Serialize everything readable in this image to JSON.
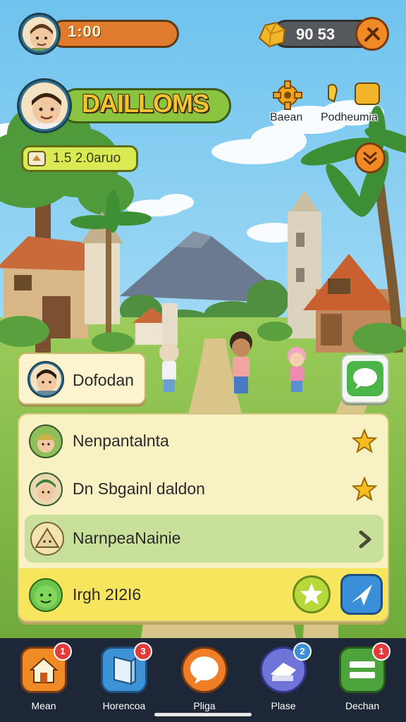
{
  "hud": {
    "coins": "1:00",
    "gems": "90 53",
    "player_name": "DAILLOMS",
    "level": "1.5 2.0aruo"
  },
  "top_icons": [
    {
      "label": "Baean",
      "icon": "gear-icon"
    },
    {
      "label": "Podheumia",
      "icon": "gift-icon"
    }
  ],
  "player_card": {
    "name": "Dofodan"
  },
  "list": [
    {
      "label": "Nenpantalnta",
      "icon": "star-icon",
      "avatar": "villager-avatar"
    },
    {
      "label": "Dn Sbgainl daldon",
      "icon": "star-icon",
      "avatar": "warrior-avatar"
    },
    {
      "label": "NarnpeaNainie",
      "icon": "chevron-right-icon",
      "avatar": "house-avatar"
    },
    {
      "label": "Irgh 2I2I6",
      "icon": "star-icon",
      "avatar": "slime-avatar"
    }
  ],
  "nav": [
    {
      "label": "Mean",
      "badge": "1",
      "color": "#f08a24",
      "icon": "home-icon"
    },
    {
      "label": "Horencoa",
      "badge": "3",
      "color": "#3e93d6",
      "icon": "book-icon"
    },
    {
      "label": "Pliga",
      "badge": "",
      "color": "#f07e28",
      "icon": "chat-icon"
    },
    {
      "label": "Plase",
      "badge": "2",
      "color": "#6f74d8",
      "icon": "hat-icon"
    },
    {
      "label": "Dechan",
      "badge": "1",
      "color": "#4ea43c",
      "icon": "menu-icon"
    }
  ],
  "colors": {
    "badge_red": "#e23b3b",
    "badge_blue": "#3b8fd9",
    "panel": "#f8f1c4",
    "highlight_row": "#c8e09a",
    "yellow_row": "#f7e55e"
  }
}
